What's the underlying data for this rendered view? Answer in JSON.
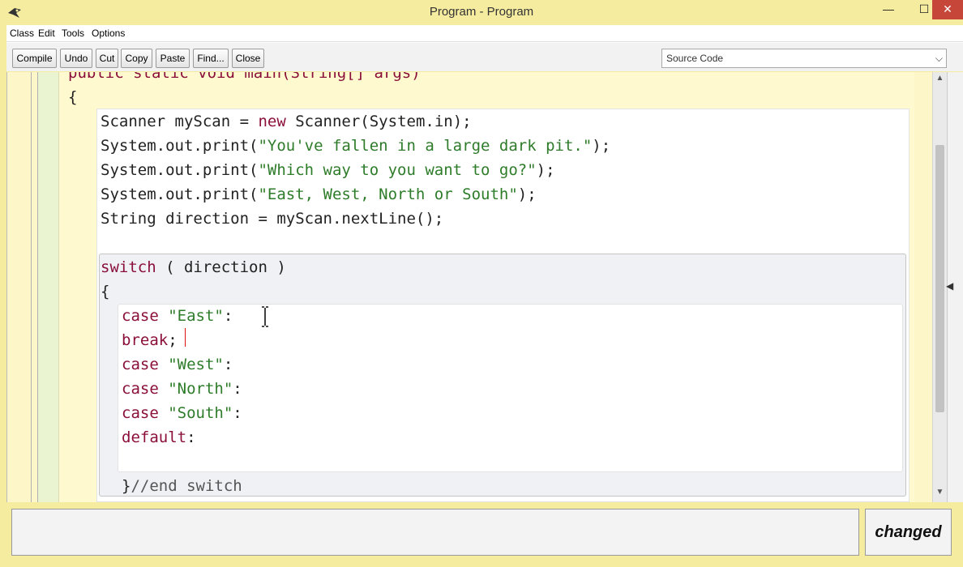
{
  "window": {
    "title": "Program - Program",
    "minimize_symbol": "—",
    "maximize_symbol": "☐",
    "close_symbol": "✕"
  },
  "menu": {
    "items": [
      "Class",
      "Edit",
      "Tools",
      "Options"
    ]
  },
  "toolbar": {
    "buttons": [
      "Compile",
      "Undo",
      "Cut",
      "Copy",
      "Paste",
      "Find...",
      "Close"
    ],
    "view_select": {
      "value": "Source Code"
    }
  },
  "editor": {
    "lines": {
      "header": "public static void main(String[] args)",
      "open_method": "{",
      "scanner_type": "Scanner myScan = ",
      "scanner_new": "new",
      "scanner_rest": " Scanner(System.in);",
      "print1_pre": "System.out.print(",
      "print1_str": "\"You've fallen in a large dark pit.\"",
      "print1_post": ");",
      "print2_pre": "System.out.print(",
      "print2_str": "\"Which way to you want to go?\"",
      "print2_post": ");",
      "print3_pre": "System.out.print(",
      "print3_str": "\"East, West, North or South\"",
      "print3_post": ");",
      "string_line": "String direction = myScan.nextLine();",
      "switch_kw": "switch",
      "switch_rest": "( direction )",
      "open_switch": "{",
      "case1_kw": "case",
      "case1_str": "\"East\"",
      "case1_colon": ":",
      "break_kw": "break",
      "break_semi": ";",
      "case2_kw": "case",
      "case2_str": "\"West\"",
      "case2_colon": ":",
      "case3_kw": "case",
      "case3_str": "\"North\"",
      "case3_colon": ":",
      "case4_kw": "case",
      "case4_str": "\"South\"",
      "case4_colon": ":",
      "default_kw": "default",
      "default_colon": ":",
      "close_switch": "}",
      "end_comment": "//end switch"
    }
  },
  "status": {
    "message": "",
    "changed_label": "changed"
  },
  "colors": {
    "keyword": "#8a0f3a",
    "string": "#2e7c2a",
    "window_bg": "#f5eca0",
    "close_button": "#c7463a"
  }
}
